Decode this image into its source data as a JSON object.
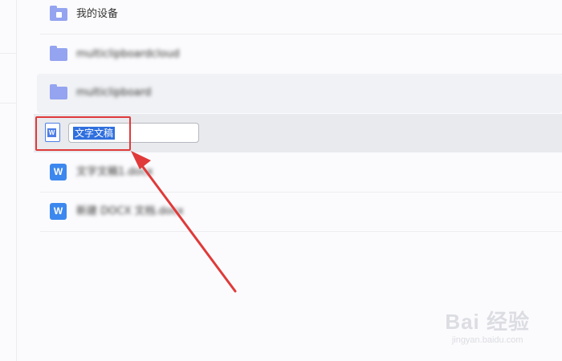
{
  "file_list": {
    "rows": [
      {
        "type": "device-folder",
        "name": "我的设备",
        "blurred": false
      },
      {
        "type": "folder",
        "name": "multiclipboardcloud",
        "blurred": true
      },
      {
        "type": "folder",
        "name": "multiclipboard",
        "blurred": true
      },
      {
        "type": "doc-renaming",
        "name": "文字文稿",
        "editing": true
      },
      {
        "type": "wps-doc",
        "name": "文字文稿1.docx",
        "blurred": true
      },
      {
        "type": "wps-doc",
        "name": "新建 DOCX 文档.docx",
        "blurred": true
      }
    ]
  },
  "icons": {
    "wps_letter": "W"
  },
  "colors": {
    "folder": "#94a4f0",
    "wps_blue": "#3d88ee",
    "highlight_red": "#e03a3a",
    "selection": "#2f6fde",
    "hover_row": "#f1f2f5",
    "selected_row": "#e8eaee"
  },
  "watermark": {
    "main": "Bai 经验",
    "sub": "jingyan.baidu.com"
  }
}
